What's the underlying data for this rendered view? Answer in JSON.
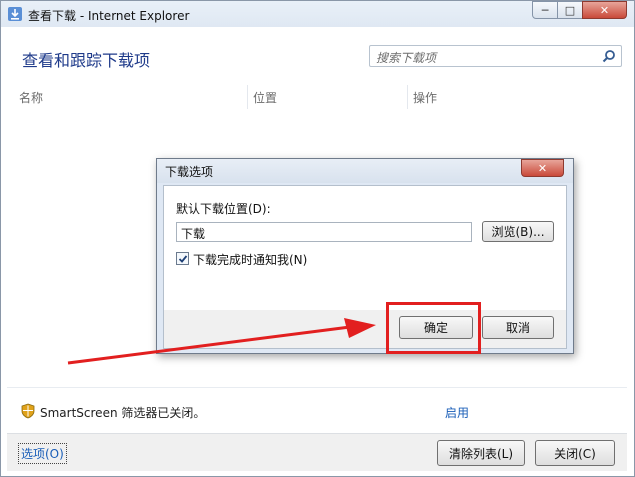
{
  "window": {
    "title": "查看下载 - Internet Explorer"
  },
  "main": {
    "heading": "查看和跟踪下载项",
    "search_placeholder": "搜索下载项",
    "columns": [
      "名称",
      "位置",
      "操作"
    ]
  },
  "smartscreen": {
    "status": "SmartScreen 筛选器已关闭。",
    "link": "启用"
  },
  "bottom": {
    "options": "选项(O)",
    "clear_list": "清除列表(L)",
    "close": "关闭(C)"
  },
  "dialog": {
    "title": "下载选项",
    "location_label": "默认下载位置(D):",
    "location_value": "下载",
    "browse": "浏览(B)...",
    "notify_label": "下载完成时通知我(N)",
    "notify_checked": true,
    "ok": "确定",
    "cancel": "取消"
  },
  "colors": {
    "accent": "#1e3a8a",
    "link": "#1a5eb8",
    "highlight": "#e21f1f"
  }
}
